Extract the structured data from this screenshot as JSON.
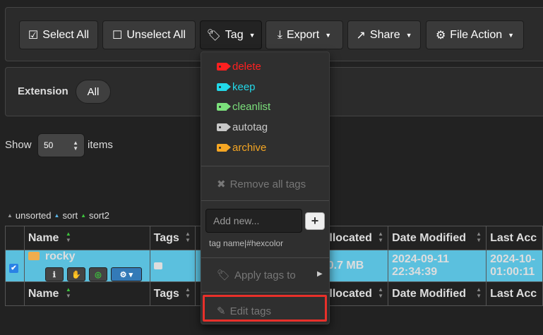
{
  "toolbar": {
    "select_all": "Select All",
    "unselect_all": "Unselect All",
    "tag": "Tag",
    "export": "Export",
    "share": "Share",
    "file_action": "File Action"
  },
  "extension": {
    "label": "Extension",
    "filter_all": "All"
  },
  "paging": {
    "show_label": "Show",
    "page_size": "50",
    "items_label": "items"
  },
  "sort_legend": {
    "unsorted": "unsorted",
    "sort": "sort",
    "sort2": "sort2"
  },
  "table": {
    "headers": [
      "Name",
      "Tags",
      "Allocated",
      "Date Modified",
      "Last Acc"
    ],
    "rows": [
      {
        "name": "rocky",
        "allocated": "30.7 MB",
        "date_modified_date": "2024-09-11",
        "date_modified_time": "22:34:39",
        "last_access_date": "2024-10-",
        "last_access_time": "01:00:11"
      }
    ]
  },
  "tag_menu": {
    "tags": [
      {
        "label": "delete",
        "color": "#ff2020"
      },
      {
        "label": "keep",
        "color": "#22d8e8"
      },
      {
        "label": "cleanlist",
        "color": "#7be07b"
      },
      {
        "label": "autotag",
        "color": "#c8c8c8"
      },
      {
        "label": "archive",
        "color": "#f5a623"
      }
    ],
    "remove_all": "Remove all tags",
    "add_new_placeholder": "Add new...",
    "add_button": "+",
    "hint": "tag name|#hexcolor",
    "apply_tags": "Apply tags to",
    "edit_tags": "Edit tags"
  },
  "colors": {
    "selected_row": "#5bc0de",
    "highlight": "#e8302a"
  }
}
